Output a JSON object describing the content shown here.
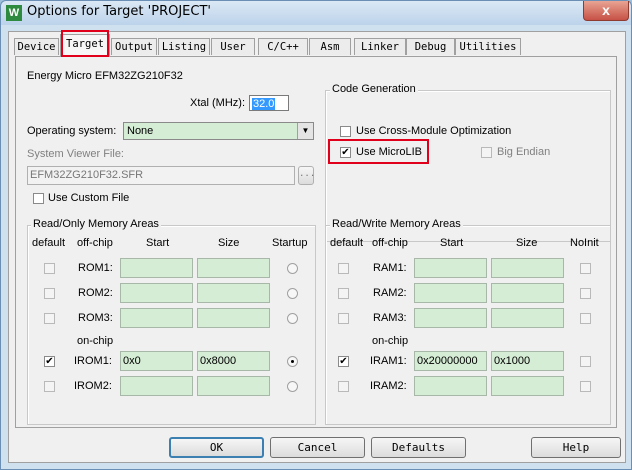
{
  "window": {
    "title": "Options for Target 'PROJECT'",
    "icon_char": "W",
    "close_glyph": "x"
  },
  "tabs": [
    "Device",
    "Target",
    "Output",
    "Listing",
    "User",
    "C/C++",
    "Asm",
    "Linker",
    "Debug",
    "Utilities"
  ],
  "active_tab": "Target",
  "device_name": "Energy Micro EFM32ZG210F32",
  "xtal": {
    "label": "Xtal (MHz):",
    "value": "32.0"
  },
  "os": {
    "label": "Operating system:",
    "value": "None"
  },
  "svf": {
    "label": "System Viewer File:",
    "value": "EFM32ZG210F32.SFR",
    "browse": "..."
  },
  "custom_file": {
    "label": "Use Custom File",
    "checked": false
  },
  "code_gen": {
    "title": "Code Generation",
    "cross_module": {
      "label": "Use Cross-Module Optimization",
      "checked": false
    },
    "microlib": {
      "label": "Use MicroLIB",
      "checked": true
    },
    "big_endian": {
      "label": "Big Endian",
      "checked": false
    }
  },
  "ro": {
    "title": "Read/Only Memory Areas",
    "headers": {
      "default": "default",
      "offchip": "off-chip",
      "start": "Start",
      "size": "Size",
      "startup": "Startup"
    },
    "onchip": "on-chip",
    "rows": [
      {
        "name": "ROM1:",
        "start": "",
        "size": "",
        "default": false,
        "startup": false
      },
      {
        "name": "ROM2:",
        "start": "",
        "size": "",
        "default": false,
        "startup": false
      },
      {
        "name": "ROM3:",
        "start": "",
        "size": "",
        "default": false,
        "startup": false
      },
      {
        "name": "IROM1:",
        "start": "0x0",
        "size": "0x8000",
        "default": true,
        "startup": true
      },
      {
        "name": "IROM2:",
        "start": "",
        "size": "",
        "default": false,
        "startup": false
      }
    ]
  },
  "rw": {
    "title": "Read/Write Memory Areas",
    "headers": {
      "default": "default",
      "offchip": "off-chip",
      "start": "Start",
      "size": "Size",
      "noinit": "NoInit"
    },
    "onchip": "on-chip",
    "rows": [
      {
        "name": "RAM1:",
        "start": "",
        "size": "",
        "default": false,
        "noinit": false
      },
      {
        "name": "RAM2:",
        "start": "",
        "size": "",
        "default": false,
        "noinit": false
      },
      {
        "name": "RAM3:",
        "start": "",
        "size": "",
        "default": false,
        "noinit": false
      },
      {
        "name": "IRAM1:",
        "start": "0x20000000",
        "size": "0x1000",
        "default": true,
        "noinit": false
      },
      {
        "name": "IRAM2:",
        "start": "",
        "size": "",
        "default": false,
        "noinit": false
      }
    ]
  },
  "buttons": {
    "ok": "OK",
    "cancel": "Cancel",
    "defaults": "Defaults",
    "help": "Help"
  },
  "check_glyph": "✔",
  "colors": {
    "field_green": "#d5ecd5",
    "highlight_red": "#e0001b",
    "selection_blue": "#3399ff"
  }
}
